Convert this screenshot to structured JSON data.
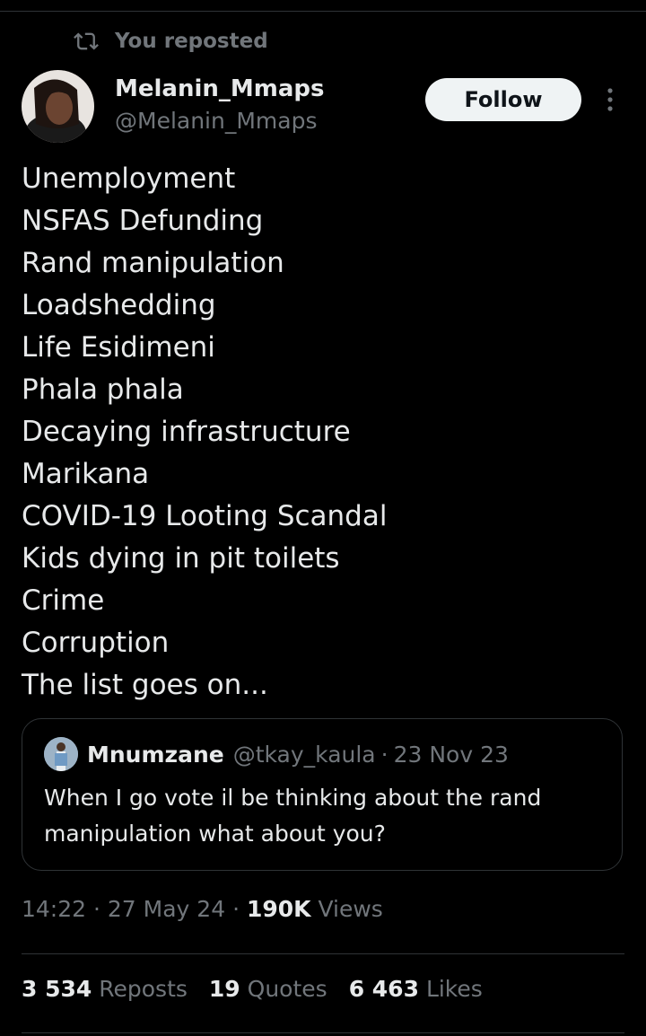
{
  "repost_context": {
    "icon": "repost-icon",
    "text": "You reposted"
  },
  "author": {
    "display_name": "Melanin_Mmaps",
    "handle": "@Melanin_Mmaps",
    "avatar": "avatar"
  },
  "follow_label": "Follow",
  "more_icon": "more-icon",
  "tweet_lines": [
    "Unemployment",
    "NSFAS Defunding",
    "Rand manipulation",
    "Loadshedding",
    "Life Esidimeni",
    "Phala phala",
    "Decaying infrastructure",
    "Marikana",
    "COVID-19 Looting Scandal",
    "Kids dying in pit toilets",
    "Crime",
    "Corruption",
    "The list goes on..."
  ],
  "quote": {
    "display_name": "Mnumzane",
    "handle": "@tkay_kaula",
    "separator": "·",
    "date": "23 Nov 23",
    "text": "When I go vote il be thinking about the rand manipulation what about you?"
  },
  "meta": {
    "time": "14:22",
    "separator": "·",
    "date": "27 May 24",
    "views_count": "190K",
    "views_label": "Views"
  },
  "stats": {
    "reposts_count": "3 534",
    "reposts_label": "Reposts",
    "quotes_count": "19",
    "quotes_label": "Quotes",
    "likes_count": "6 463",
    "likes_label": "Likes"
  },
  "colors": {
    "background": "#000000",
    "text_primary": "#e7e9ea",
    "text_secondary": "#71767b",
    "border": "#2f3336",
    "follow_bg": "#eff3f4"
  }
}
